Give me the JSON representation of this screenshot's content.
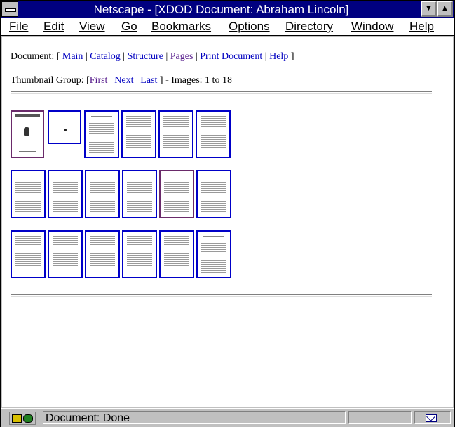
{
  "window": {
    "title": "Netscape - [XDOD Document: Abraham Lincoln]",
    "minimize_glyph": "▼",
    "maximize_glyph": "▲"
  },
  "menu": [
    "File",
    "Edit",
    "View",
    "Go",
    "Bookmarks",
    "Options",
    "Directory",
    "Window",
    "Help"
  ],
  "document_nav": {
    "label": "Document: [",
    "links": [
      "Main",
      "Catalog",
      "Structure",
      "Pages",
      "Print Document",
      "Help"
    ],
    "close": "]"
  },
  "thumbnail_nav": {
    "label": "Thumbnail Group: [",
    "links": [
      "First",
      "Next",
      "Last"
    ],
    "suffix": "] - Images: 1 to 18"
  },
  "thumbnails": {
    "count": 18,
    "visited": [
      1,
      11
    ]
  },
  "status": {
    "text": "Document: Done"
  },
  "colors": {
    "titlebar": "#000080",
    "link": "#0000c0",
    "visited_link": "#551a8b",
    "thumb_border": "#0000c8"
  }
}
